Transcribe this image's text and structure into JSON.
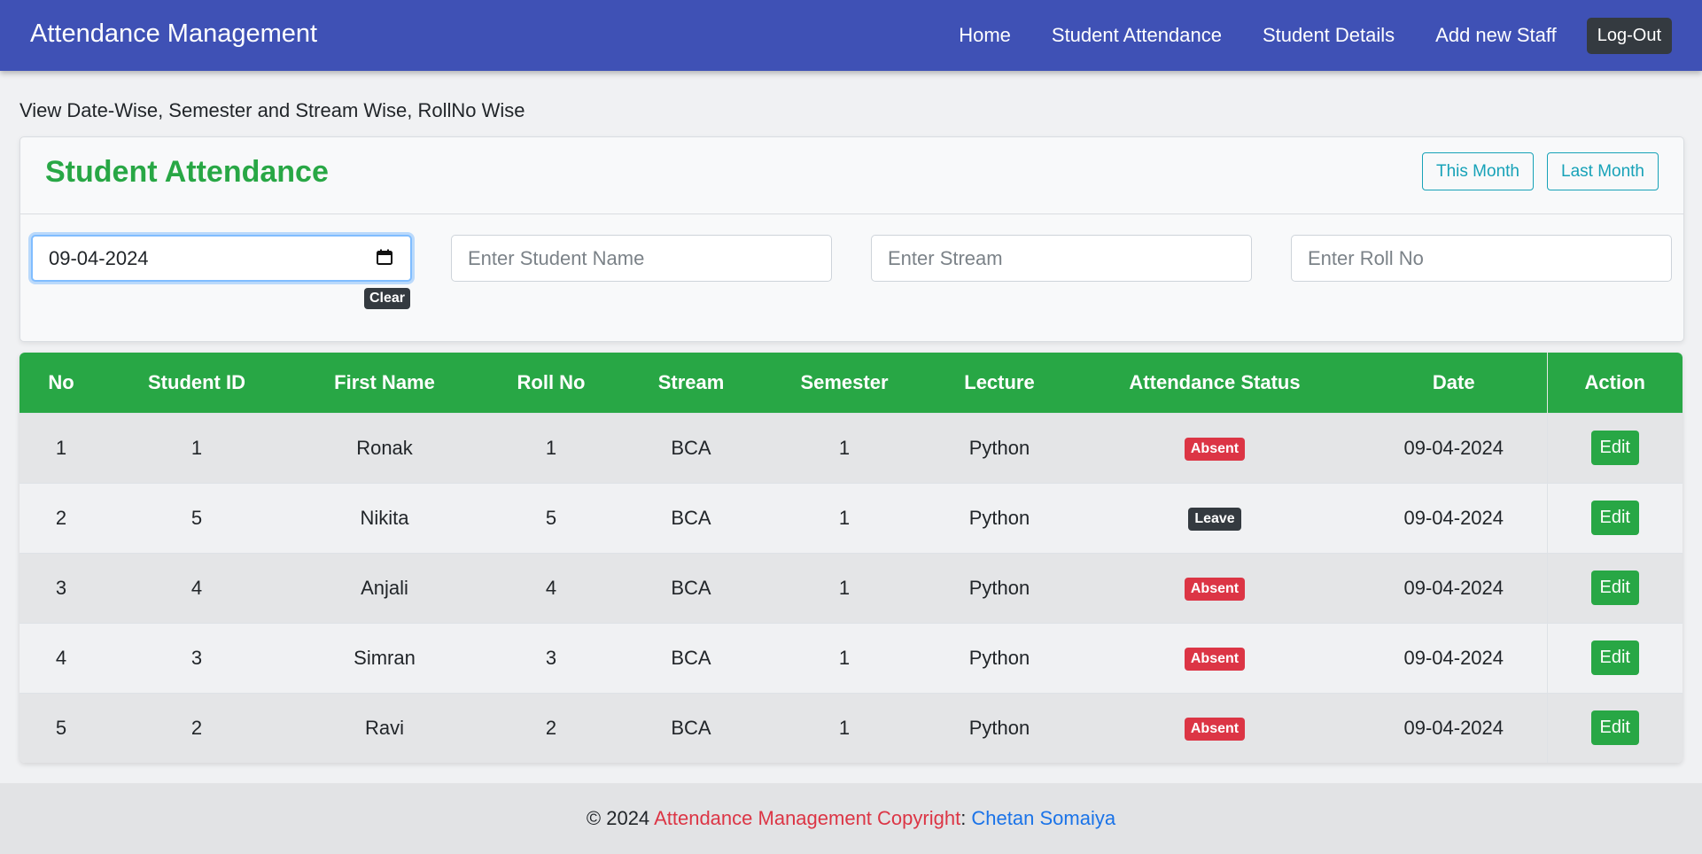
{
  "navbar": {
    "brand": "Attendance Management",
    "links": [
      "Home",
      "Student Attendance",
      "Student Details",
      "Add new Staff"
    ],
    "logout": "Log-Out"
  },
  "subtitle": "View Date-Wise, Semester and Stream Wise, RollNo Wise",
  "card": {
    "title": "Student Attendance",
    "this_month": "This Month",
    "last_month": "Last Month"
  },
  "filters": {
    "date_value": "09-04-2024",
    "clear": "Clear",
    "student_name_placeholder": "Enter Student Name",
    "stream_placeholder": "Enter Stream",
    "roll_no_placeholder": "Enter Roll No"
  },
  "table": {
    "headers": [
      "No",
      "Student ID",
      "First Name",
      "Roll No",
      "Stream",
      "Semester",
      "Lecture",
      "Attendance Status",
      "Date",
      "Action"
    ],
    "rows": [
      {
        "no": "1",
        "student_id": "1",
        "first_name": "Ronak",
        "roll_no": "1",
        "stream": "BCA",
        "semester": "1",
        "lecture": "Python",
        "status": "Absent",
        "date": "09-04-2024",
        "action": "Edit"
      },
      {
        "no": "2",
        "student_id": "5",
        "first_name": "Nikita",
        "roll_no": "5",
        "stream": "BCA",
        "semester": "1",
        "lecture": "Python",
        "status": "Leave",
        "date": "09-04-2024",
        "action": "Edit"
      },
      {
        "no": "3",
        "student_id": "4",
        "first_name": "Anjali",
        "roll_no": "4",
        "stream": "BCA",
        "semester": "1",
        "lecture": "Python",
        "status": "Absent",
        "date": "09-04-2024",
        "action": "Edit"
      },
      {
        "no": "4",
        "student_id": "3",
        "first_name": "Simran",
        "roll_no": "3",
        "stream": "BCA",
        "semester": "1",
        "lecture": "Python",
        "status": "Absent",
        "date": "09-04-2024",
        "action": "Edit"
      },
      {
        "no": "5",
        "student_id": "2",
        "first_name": "Ravi",
        "roll_no": "2",
        "stream": "BCA",
        "semester": "1",
        "lecture": "Python",
        "status": "Absent",
        "date": "09-04-2024",
        "action": "Edit"
      }
    ]
  },
  "footer": {
    "prefix": "© 2024 ",
    "app_copyright": "Attendance Management Copyright",
    "separator": ": ",
    "author": "Chetan Somaiya"
  },
  "colors": {
    "navbar": "#3f51b5",
    "accent_green": "#28a745",
    "absent": "#dc3545",
    "leave": "#343a40",
    "info_outline": "#17a2b8"
  },
  "icons": {
    "date_picker": "calendar-icon"
  }
}
